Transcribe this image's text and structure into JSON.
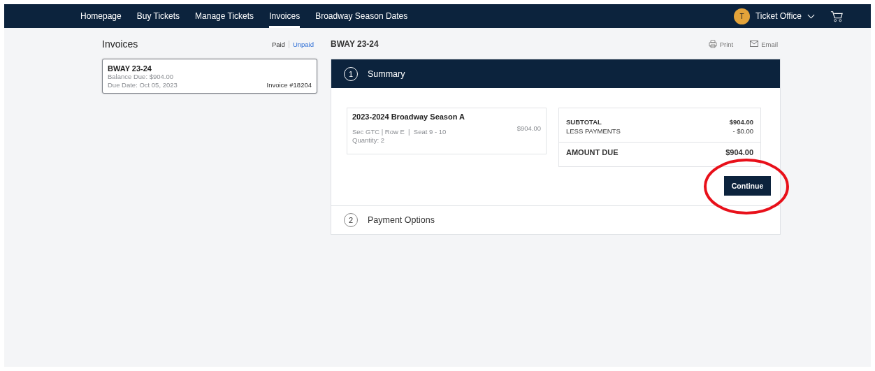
{
  "nav": {
    "items": [
      {
        "label": "Homepage",
        "selected": false
      },
      {
        "label": "Buy Tickets",
        "selected": false
      },
      {
        "label": "Manage Tickets",
        "selected": false
      },
      {
        "label": "Invoices",
        "selected": true
      },
      {
        "label": "Broadway Season Dates",
        "selected": false
      }
    ],
    "avatar": "T",
    "account": "Ticket Office"
  },
  "invoices": {
    "title": "Invoices",
    "filters": [
      {
        "label": "Paid",
        "selected": false
      },
      {
        "label": "Unpaid",
        "selected": true
      }
    ],
    "list": [
      {
        "name": "BWAY 23-24",
        "balance": "Balance Due: $904.00",
        "due": "Due Date: Oct 05, 2023",
        "number": "Invoice #18204",
        "selected": true
      }
    ]
  },
  "detail": {
    "title": "BWAY 23-24",
    "actions": [
      {
        "kind": "print",
        "label": "Print"
      },
      {
        "kind": "email",
        "label": "Email"
      }
    ],
    "steps": [
      {
        "number": "1",
        "title": "Summary",
        "expanded": true
      },
      {
        "number": "2",
        "title": "Payment Options",
        "expanded": false
      }
    ],
    "item": {
      "name": "2023-2024 Broadway Season A",
      "seats": "Sec GTC | Row E  |  Seat 9 - 10",
      "quantity": "Quantity: 2",
      "price": "$904.00"
    },
    "totals": [
      {
        "label": "SUBTOTAL",
        "value": "$904.00",
        "kind": "line"
      },
      {
        "label": "LESS PAYMENTS",
        "value": "- $0.00",
        "kind": "line"
      },
      {
        "label": "AMOUNT DUE",
        "value": "$904.00",
        "kind": "total"
      }
    ],
    "button": "Continue"
  }
}
